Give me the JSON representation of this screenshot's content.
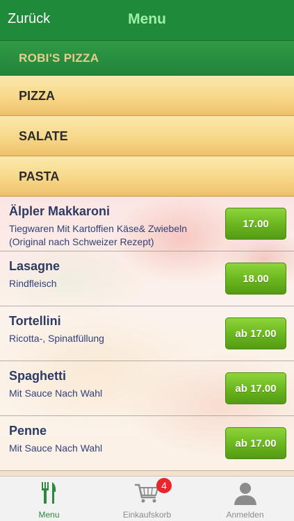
{
  "navbar": {
    "back_label": "Zurück",
    "title": "Menu"
  },
  "restaurant": {
    "name": "ROBI'S PIZZA"
  },
  "categories": [
    {
      "label": "PIZZA"
    },
    {
      "label": "SALATE"
    },
    {
      "label": "PASTA"
    }
  ],
  "items": [
    {
      "name": "Älpler Makkaroni",
      "description": "Tiegwaren Mit Kartoffien Käse& Zwiebeln (Original nach Schweizer Rezept)",
      "price": "17.00"
    },
    {
      "name": "Lasagne",
      "description": "Rindfleisch",
      "price": "18.00"
    },
    {
      "name": "Tortellini",
      "description": "Ricotta-, Spinatfüllung",
      "price": "ab 17.00"
    },
    {
      "name": "Spaghetti",
      "description": "Mit Sauce Nach Wahl",
      "price": "ab 17.00"
    },
    {
      "name": "Penne",
      "description": "Mit Sauce Nach Wahl",
      "price": "ab 17.00"
    }
  ],
  "tabbar": {
    "tabs": [
      {
        "label": "Menu",
        "icon": "fork-knife-icon",
        "active": true
      },
      {
        "label": "Einkaufskorb",
        "icon": "shopping-cart-icon",
        "badge": "4"
      },
      {
        "label": "Anmelden",
        "icon": "user-icon"
      }
    ]
  },
  "colors": {
    "brand_green": "#1f8a3a",
    "price_green": "#6cb820",
    "badge_red": "#e8262c"
  }
}
